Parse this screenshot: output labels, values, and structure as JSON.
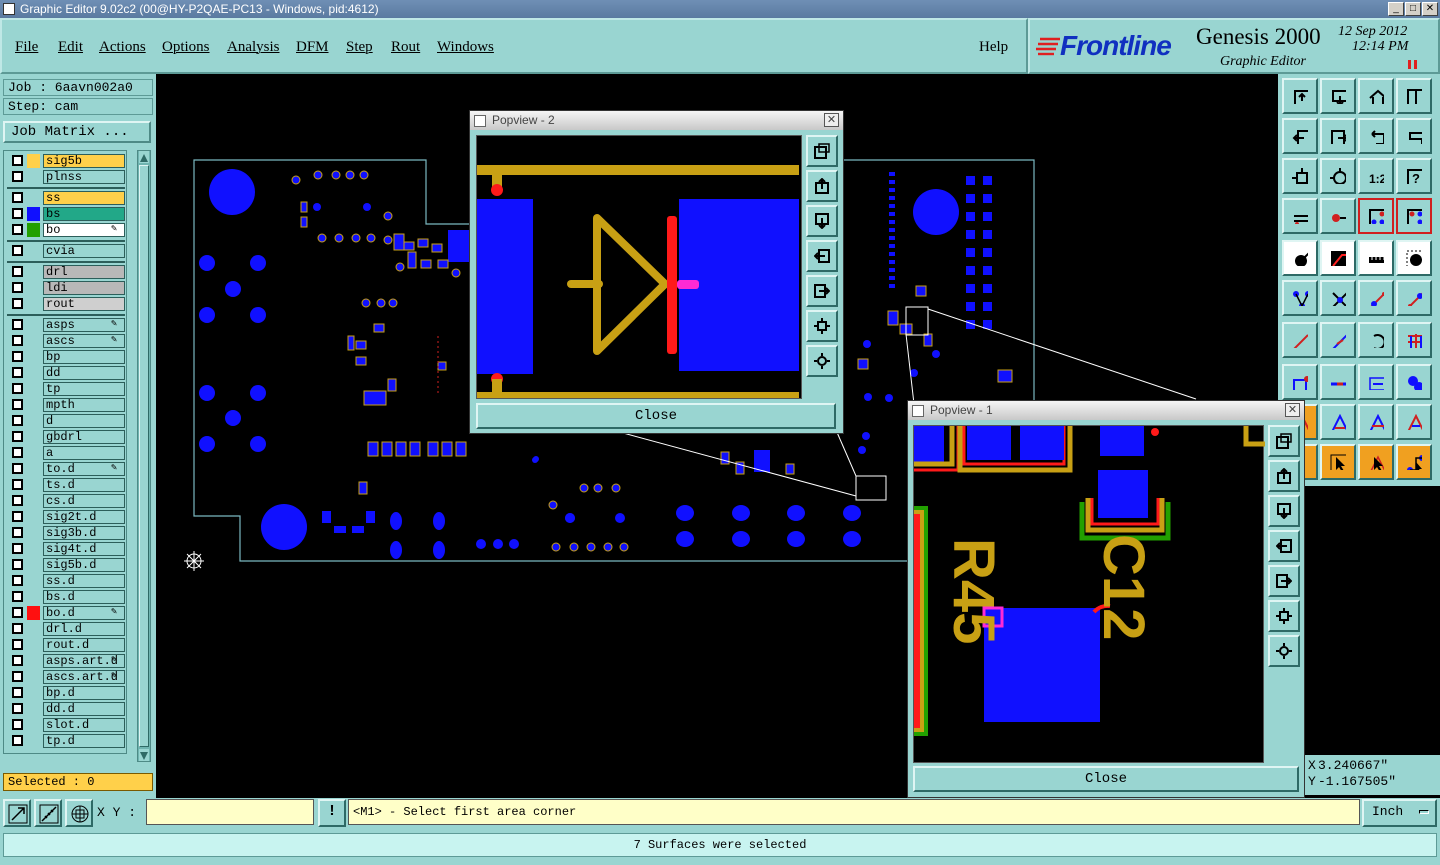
{
  "window": {
    "title": "Graphic Editor 9.02c2 (00@HY-P2QAE-PC13 - Windows, pid:4612)",
    "min_label": "_",
    "max_label": "□",
    "close_label": "✕"
  },
  "menu": {
    "items": [
      "File",
      "Edit",
      "Actions",
      "Options",
      "Analysis",
      "DFM",
      "Step",
      "Rout",
      "Windows"
    ],
    "help": "Help"
  },
  "brand": {
    "logo": "Frontline",
    "product": "Genesis 2000",
    "subtitle": "Graphic Editor",
    "date": "12 Sep 2012",
    "time": "12:14 PM"
  },
  "job": {
    "job_label": "Job : 6aavn002a0",
    "step_label": "Step: cam",
    "matrix_button": "Job Matrix ..."
  },
  "layers": [
    {
      "name": "sig5b",
      "color": "#ffd04a",
      "fill": "#ffd04a"
    },
    {
      "name": "plnss",
      "color": "",
      "fill": "#99d5d1"
    },
    {
      "name": "ss",
      "color": "",
      "fill": "#ffd04a"
    },
    {
      "name": "bs",
      "color": "#1010ff",
      "fill": "#22a888"
    },
    {
      "name": "bo",
      "color": "#22a000",
      "fill": "#ffffff",
      "mark": "✎"
    },
    {
      "name": "cvia",
      "color": "",
      "fill": "#99d5d1"
    },
    {
      "name": "drl",
      "color": "",
      "fill": "#b8b8b8"
    },
    {
      "name": "ldi",
      "color": "",
      "fill": "#b8b8b8"
    },
    {
      "name": "rout",
      "color": "",
      "fill": "#cfcfcf"
    },
    {
      "name": "asps",
      "color": "",
      "fill": "#99d5d1",
      "mark": "✎"
    },
    {
      "name": "ascs",
      "color": "",
      "fill": "#99d5d1",
      "mark": "✎"
    },
    {
      "name": "bp",
      "color": "",
      "fill": "#99d5d1"
    },
    {
      "name": "dd",
      "color": "",
      "fill": "#99d5d1"
    },
    {
      "name": "tp",
      "color": "",
      "fill": "#99d5d1"
    },
    {
      "name": "mpth",
      "color": "",
      "fill": "#99d5d1"
    },
    {
      "name": "d",
      "color": "",
      "fill": "#99d5d1"
    },
    {
      "name": "gbdrl",
      "color": "",
      "fill": "#99d5d1"
    },
    {
      "name": "a",
      "color": "",
      "fill": "#99d5d1"
    },
    {
      "name": "to.d",
      "color": "",
      "fill": "#99d5d1",
      "mark": "✎"
    },
    {
      "name": "ts.d",
      "color": "",
      "fill": "#99d5d1"
    },
    {
      "name": "cs.d",
      "color": "",
      "fill": "#99d5d1"
    },
    {
      "name": "sig2t.d",
      "color": "",
      "fill": "#99d5d1"
    },
    {
      "name": "sig3b.d",
      "color": "",
      "fill": "#99d5d1"
    },
    {
      "name": "sig4t.d",
      "color": "",
      "fill": "#99d5d1"
    },
    {
      "name": "sig5b.d",
      "color": "",
      "fill": "#99d5d1"
    },
    {
      "name": "ss.d",
      "color": "",
      "fill": "#99d5d1"
    },
    {
      "name": "bs.d",
      "color": "",
      "fill": "#99d5d1"
    },
    {
      "name": "bo.d",
      "color": "#ff1010",
      "fill": "#99d5d1",
      "mark": "✎"
    },
    {
      "name": "drl.d",
      "color": "",
      "fill": "#99d5d1"
    },
    {
      "name": "rout.d",
      "color": "",
      "fill": "#99d5d1"
    },
    {
      "name": "asps.art.d",
      "color": "",
      "fill": "#99d5d1",
      "mark": "✎"
    },
    {
      "name": "ascs.art.d",
      "color": "",
      "fill": "#99d5d1",
      "mark": "✎"
    },
    {
      "name": "bp.d",
      "color": "",
      "fill": "#99d5d1"
    },
    {
      "name": "dd.d",
      "color": "",
      "fill": "#99d5d1"
    },
    {
      "name": "slot.d",
      "color": "",
      "fill": "#99d5d1"
    },
    {
      "name": "tp.d",
      "color": "",
      "fill": "#99d5d1"
    }
  ],
  "selected": "Selected : 0",
  "popview2": {
    "title": "Popview - 2",
    "close": "Close"
  },
  "popview1": {
    "title": "Popview - 1",
    "close": "Close",
    "silk_text_1": "R45",
    "silk_text_2": "C12"
  },
  "coordinates": {
    "x": "3.240667\"",
    "y": "-1.167505\""
  },
  "bottom": {
    "xy_label": "X Y :",
    "xy_value": "",
    "message_icon": "!",
    "message": "<M1> - Select first area corner",
    "units": "Inch"
  },
  "status": "7 Surfaces were selected",
  "colors": {
    "panel": "#99d5d1",
    "signal_blue": "#1010ff",
    "silk": "#c8a014",
    "highlight": "#ff1a1a"
  }
}
